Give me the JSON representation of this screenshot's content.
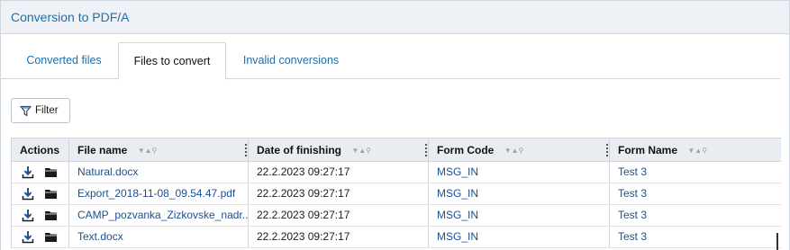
{
  "panel": {
    "title": "Conversion to PDF/A"
  },
  "tabs": [
    {
      "label": "Converted files",
      "active": false
    },
    {
      "label": "Files to convert",
      "active": true
    },
    {
      "label": "Invalid conversions",
      "active": false
    }
  ],
  "toolbar": {
    "filter_label": "Filter",
    "filter_icon": "filter-icon"
  },
  "grid": {
    "columns": [
      "Actions",
      "File name",
      "Date of finishing",
      "Form Code",
      "Form Name"
    ],
    "sortable_columns": [
      "File name",
      "Date of finishing",
      "Form Code",
      "Form Name"
    ],
    "action_icons": [
      "download-icon",
      "folder-icon"
    ],
    "rows": [
      {
        "file_name": "Natural.docx",
        "date": "22.2.2023 09:27:17",
        "form_code": "MSG_IN",
        "form_name": "Test 3"
      },
      {
        "file_name": "Export_2018-11-08_09.54.47.pdf",
        "date": "22.2.2023 09:27:17",
        "form_code": "MSG_IN",
        "form_name": "Test 3"
      },
      {
        "file_name": "CAMP_pozvanka_Zizkovske_nadr...",
        "date": "22.2.2023 09:27:17",
        "form_code": "MSG_IN",
        "form_name": "Test 3"
      },
      {
        "file_name": "Text.docx",
        "date": "22.2.2023 09:27:17",
        "form_code": "MSG_IN",
        "form_name": "Test 3"
      }
    ]
  },
  "colors": {
    "link": "#1d4f91",
    "accent": "#1f6fa8",
    "header_bg": "#e9edf2",
    "panel_header_bg": "#eef1f5"
  }
}
